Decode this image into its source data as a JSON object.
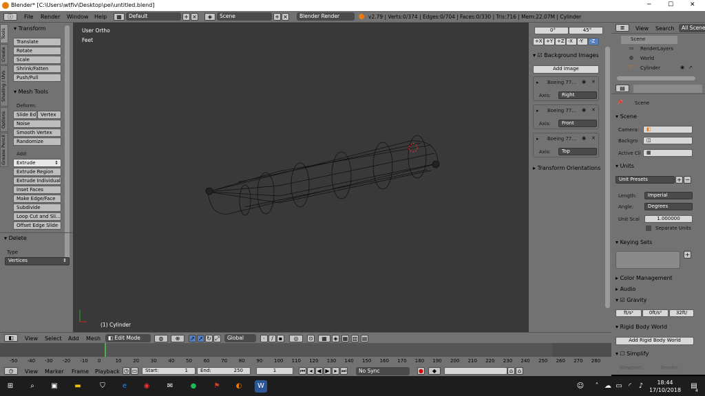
{
  "window": {
    "title": "Blender* [C:\\Users\\wtfiv\\Desktop\\pei\\untitled.blend]",
    "minimize": "─",
    "maximize": "☐",
    "close": "✕"
  },
  "infobar": {
    "menus": [
      "File",
      "Render",
      "Window",
      "Help"
    ],
    "layout": "Default",
    "scene": "Scene",
    "engine": "Blender Render",
    "stats": "v2.79 | Verts:0/374 | Edges:0/704 | Faces:0/330 | Tris:716 | Mem:22.07M | Cylinder"
  },
  "toolshelf": {
    "tabs": [
      "Tools",
      "Create",
      "Shading / UVs",
      "Options",
      "Grease Pencil"
    ],
    "transform": {
      "title": "Transform",
      "buttons": [
        "Translate",
        "Rotate",
        "Scale",
        "Shrink/Fatten",
        "Push/Pull"
      ]
    },
    "meshtools": {
      "title": "Mesh Tools",
      "deform_label": "Deform:",
      "slide_edge": "Slide Ed",
      "vertex": "Vertex",
      "deform_buttons": [
        "Noise",
        "Smooth Vertex",
        "Randomize"
      ],
      "add_label": "Add:",
      "extrude": "Extrude",
      "add_buttons": [
        "Extrude Region",
        "Extrude Individual",
        "Inset Faces",
        "Make Edge/Face",
        "Subdivide",
        "Loop Cut and Sli...",
        "Offset Edge Slide"
      ]
    },
    "delete": {
      "title": "Delete",
      "type_label": "Type",
      "type_value": "Vertices"
    }
  },
  "viewport": {
    "view_name": "User Ortho",
    "units": "Feet",
    "object": "(1) Cylinder"
  },
  "npanel": {
    "rot_a": "0°",
    "rot_b": "45°",
    "axes": [
      "+X",
      "+Y",
      "+Z",
      "-X",
      "-Y",
      "-Z"
    ],
    "bg_title": "Background Images",
    "add_image": "Add Image",
    "images": [
      {
        "name": "Boeing 77...",
        "axis_label": "Axis:",
        "axis": "Right"
      },
      {
        "name": "Boeing 77...",
        "axis_label": "Axis:",
        "axis": "Front"
      },
      {
        "name": "Boeing 77...",
        "axis_label": "Axis:",
        "axis": "Top"
      }
    ],
    "transform_orient": "Transform Orientations"
  },
  "outliner": {
    "view": "View",
    "search": "Search",
    "filter": "All Scenes",
    "items": [
      "Scene",
      "RenderLayers",
      "World",
      "Cylinder"
    ]
  },
  "properties": {
    "breadcrumb": "Scene",
    "scene_title": "Scene",
    "camera_label": "Camera:",
    "background_label": "Backgro",
    "active_clip_label": "Active Cli",
    "units_title": "Units",
    "unit_presets": "Unit Presets",
    "length_label": "Length:",
    "length": "Imperial",
    "angle_label": "Angle:",
    "angle": "Degrees",
    "unit_scale_label": "Unit Scal",
    "unit_scale": "1.000000",
    "separate_units": "Separate Units",
    "keying_title": "Keying Sets",
    "color_mgmt": "Color Management",
    "audio": "Audio",
    "gravity_title": "Gravity",
    "gravity_vals": [
      "ft/s²",
      "0ft/s²",
      "32ft/"
    ],
    "rigid_title": "Rigid Body World",
    "rigid_btn": "Add Rigid Body World",
    "simplify": "Simplify",
    "viewport": "Viewport:",
    "render": "Render:"
  },
  "viewheader": {
    "menus": [
      "View",
      "Select",
      "Add",
      "Mesh"
    ],
    "mode": "Edit Mode",
    "orientation": "Global"
  },
  "timeline": {
    "ticks": [
      "-50",
      "-40",
      "-30",
      "-20",
      "-10",
      "0",
      "10",
      "20",
      "30",
      "40",
      "50",
      "60",
      "70",
      "80",
      "90",
      "100",
      "110",
      "120",
      "130",
      "140",
      "150",
      "160",
      "170",
      "180",
      "190",
      "200",
      "210",
      "220",
      "230",
      "240",
      "250",
      "260",
      "270",
      "280"
    ],
    "menus": [
      "View",
      "Marker",
      "Frame",
      "Playback"
    ],
    "start": "Start:",
    "start_val": "1",
    "end": "End:",
    "end_val": "250",
    "current": "1",
    "sync": "No Sync"
  },
  "taskbar": {
    "time": "18:44",
    "date": "17/10/2018",
    "notif": "4"
  }
}
